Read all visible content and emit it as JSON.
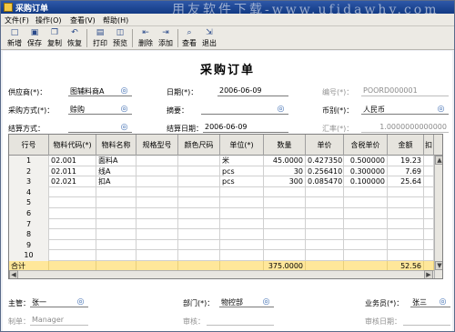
{
  "window": {
    "title": "采购订单",
    "watermark": "用友软件下载-www.ufidawhy.com"
  },
  "menu": [
    "文件(F)",
    "操作(O)",
    "查看(V)",
    "帮助(H)"
  ],
  "toolbar": [
    {
      "label": "新增",
      "icon": "new-doc-icon"
    },
    {
      "label": "保存",
      "icon": "save-icon"
    },
    {
      "label": "复制",
      "icon": "copy-icon"
    },
    {
      "label": "恢复",
      "icon": "undo-icon"
    },
    {
      "label": "打印",
      "icon": "print-icon"
    },
    {
      "label": "预览",
      "icon": "preview-icon"
    },
    {
      "label": "删除",
      "icon": "delete-row-icon"
    },
    {
      "label": "添加",
      "icon": "add-row-icon"
    },
    {
      "label": "查看",
      "icon": "view-icon"
    },
    {
      "label": "退出",
      "icon": "exit-icon"
    }
  ],
  "form": {
    "title": "采购订单",
    "supplier": {
      "label": "供应商(*)：",
      "value": "图辅料商A"
    },
    "date": {
      "label": "日期(*)：",
      "value": "2006-06-09"
    },
    "number": {
      "label": "编号(*)：",
      "value": "POORD000001"
    },
    "purchase_method": {
      "label": "采购方式(*)：",
      "value": "赊购"
    },
    "summary": {
      "label": "摘要：",
      "value": ""
    },
    "currency": {
      "label": "币别(*)：",
      "value": "人民币"
    },
    "settle_method": {
      "label": "结算方式：",
      "value": ""
    },
    "settle_date": {
      "label": "结算日期：",
      "value": "2006-06-09"
    },
    "exchange_rate": {
      "label": "汇率(*)：",
      "value": "1.0000000000000"
    }
  },
  "table": {
    "columns": [
      "行号",
      "物料代码(*)",
      "物料名称",
      "规格型号",
      "颜色尺码",
      "单位(*)",
      "数量",
      "单价",
      "含税单价",
      "金额",
      "扣"
    ],
    "rows": [
      {
        "no": "1",
        "code": "02.001",
        "name": "面料A",
        "spec": "",
        "color": "",
        "unit": "米",
        "qty": "45.0000",
        "price": "0.427350",
        "tax_price": "0.500000",
        "amount": "19.23"
      },
      {
        "no": "2",
        "code": "02.011",
        "name": "线A",
        "spec": "",
        "color": "",
        "unit": "pcs",
        "qty": "30",
        "price": "0.256410",
        "tax_price": "0.300000",
        "amount": "7.69"
      },
      {
        "no": "3",
        "code": "02.021",
        "name": "扣A",
        "spec": "",
        "color": "",
        "unit": "pcs",
        "qty": "300",
        "price": "0.085470",
        "tax_price": "0.100000",
        "amount": "25.64"
      },
      {
        "no": "4"
      },
      {
        "no": "5"
      },
      {
        "no": "6"
      },
      {
        "no": "7"
      },
      {
        "no": "8"
      },
      {
        "no": "9"
      },
      {
        "no": "10"
      }
    ],
    "total": {
      "label": "合计",
      "qty": "375.0000",
      "amount": "52.56"
    }
  },
  "footer": {
    "manager": {
      "label": "主管：",
      "value": "张一"
    },
    "department": {
      "label": "部门(*)：",
      "value": "物控部"
    },
    "salesman": {
      "label": "业务员(*)：",
      "value": "张三"
    },
    "maker": {
      "label": "制单：",
      "value": "Manager"
    },
    "reviewer": {
      "label": "审核：",
      "value": ""
    },
    "review_date": {
      "label": "审核日期：",
      "value": ""
    }
  }
}
